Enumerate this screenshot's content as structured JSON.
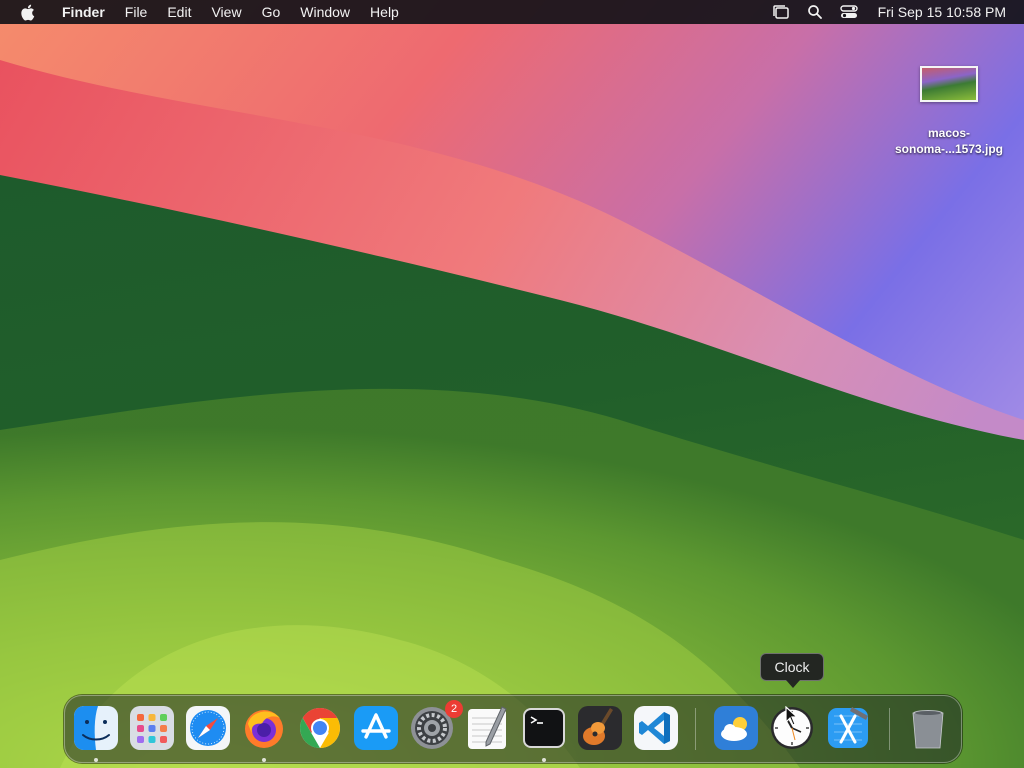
{
  "menubar": {
    "app_name": "Finder",
    "menus": [
      "File",
      "Edit",
      "View",
      "Go",
      "Window",
      "Help"
    ],
    "clock": "Fri Sep 15  10:58 PM",
    "status_icons": [
      "stage-manager-icon",
      "spotlight-search-icon",
      "control-center-icon"
    ]
  },
  "desktop": {
    "file_label_line1": "macos-",
    "file_label_line2": "sonoma-...1573.jpg"
  },
  "tooltip": {
    "text": "Clock"
  },
  "dock": {
    "items": [
      {
        "name": "Finder",
        "icon": "finder-icon",
        "running": true
      },
      {
        "name": "Launchpad",
        "icon": "launchpad-icon",
        "running": false
      },
      {
        "name": "Safari",
        "icon": "safari-icon",
        "running": false
      },
      {
        "name": "Firefox",
        "icon": "firefox-icon",
        "running": true
      },
      {
        "name": "Google Chrome",
        "icon": "chrome-icon",
        "running": false
      },
      {
        "name": "App Store",
        "icon": "app-store-icon",
        "running": false
      },
      {
        "name": "System Settings",
        "icon": "system-settings-icon",
        "running": false,
        "badge": "2"
      },
      {
        "name": "TextEdit",
        "icon": "textedit-icon",
        "running": false
      },
      {
        "name": "Terminal",
        "icon": "terminal-icon",
        "running": true
      },
      {
        "name": "GarageBand",
        "icon": "garageband-icon",
        "running": false
      },
      {
        "name": "Visual Studio Code",
        "icon": "vscode-icon",
        "running": false
      },
      {
        "name": "Weather",
        "icon": "weather-icon",
        "running": false
      },
      {
        "name": "Clock",
        "icon": "clock-icon",
        "running": false
      },
      {
        "name": "Xcode",
        "icon": "xcode-icon",
        "running": false
      },
      {
        "name": "Trash",
        "icon": "trash-icon",
        "running": false
      }
    ]
  },
  "colors": {
    "menubar_bg": "#141218",
    "badge_red": "#ec3c33",
    "wallpaper_green": "#3f7a2a",
    "wallpaper_pink": "#ec6a6e",
    "wallpaper_purple": "#8a72dd"
  }
}
